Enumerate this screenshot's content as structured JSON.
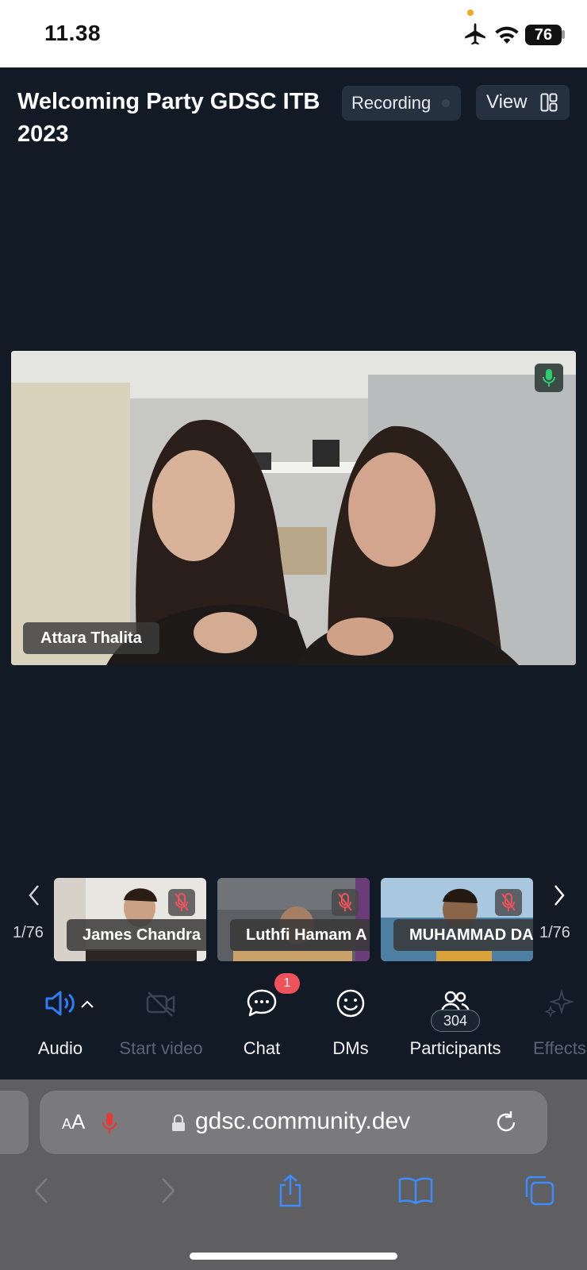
{
  "status_bar": {
    "time": "11.38",
    "battery": "76"
  },
  "meeting": {
    "title": "Welcoming Party GDSC ITB 2023",
    "recording_label": "Recording",
    "view_label": "View"
  },
  "main_video": {
    "speaker_name": "Attara Thalita"
  },
  "thumbnails": {
    "page_left": "1/76",
    "page_right": "1/76",
    "participants": [
      {
        "name": "James Chandra"
      },
      {
        "name": "Luthfi Hamam A"
      },
      {
        "name": "MUHAMMAD DA"
      }
    ]
  },
  "toolbar": {
    "audio": "Audio",
    "start_video": "Start video",
    "chat": "Chat",
    "chat_badge": "1",
    "dms": "DMs",
    "participants": "Participants",
    "participants_count": "304",
    "effects": "Effects"
  },
  "browser": {
    "url": "gdsc.community.dev"
  },
  "colors": {
    "background": "#121a25",
    "accent_blue": "#2f7cf6",
    "mic_active": "#2ecc71",
    "mic_muted": "#f0525c",
    "badge": "#f0525c"
  }
}
